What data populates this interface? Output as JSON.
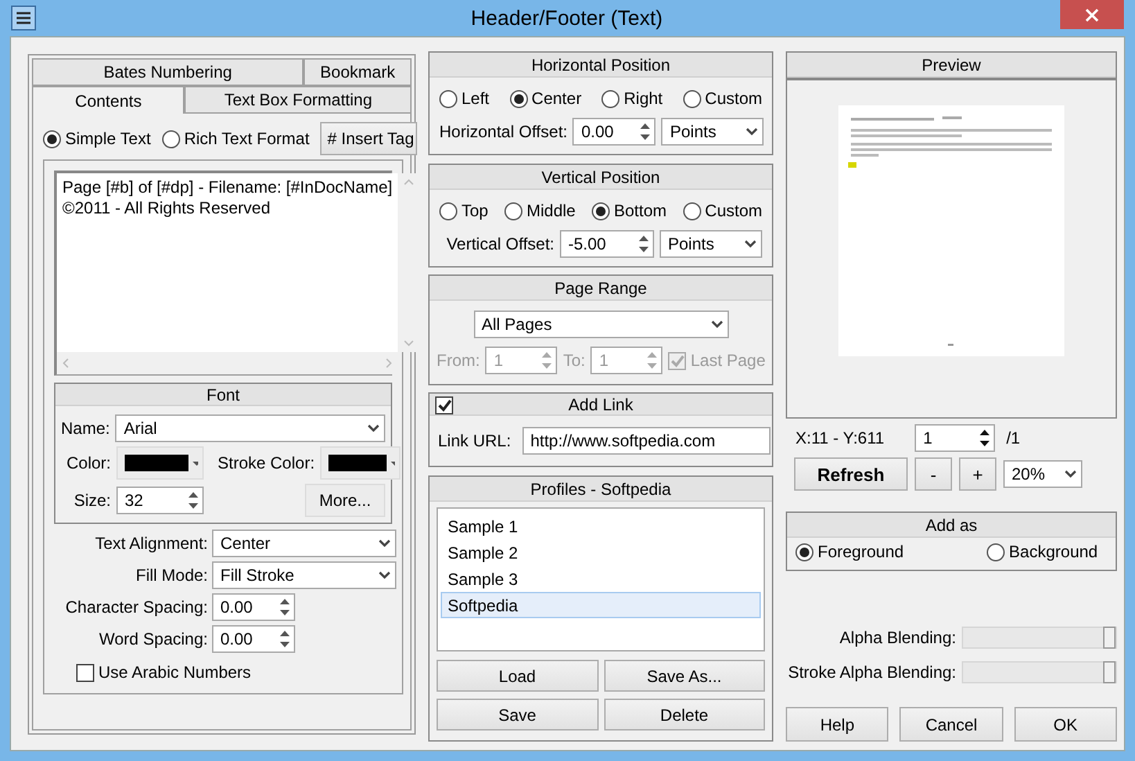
{
  "window": {
    "title": "Header/Footer (Text)"
  },
  "tab_rows": [
    [
      {
        "label": "Bates Numbering",
        "selected": false
      },
      {
        "label": "Bookmark",
        "selected": false
      }
    ],
    [
      {
        "label": "Contents",
        "selected": true
      },
      {
        "label": "Text Box Formatting",
        "selected": false
      }
    ]
  ],
  "content_mode": [
    {
      "label": "Simple Text",
      "selected": true
    },
    {
      "label": "Rich Text Format",
      "selected": false
    }
  ],
  "insert_tag_button": "# Insert Tag",
  "text_lines": [
    "Page [#b] of [#dp] - Filename: [#InDocName]",
    "©2011 - All Rights Reserved"
  ],
  "font": {
    "title": "Font",
    "name_label": "Name:",
    "name_value": "Arial",
    "swatches": [
      {
        "label": "Color:",
        "color": "#000000"
      },
      {
        "label": "Stroke Color:",
        "color": "#000000"
      }
    ],
    "size_label": "Size:",
    "size_value": "32",
    "more_button": "More..."
  },
  "format_fields": [
    {
      "kind": "select",
      "label": "Text Alignment:",
      "value": "Center"
    },
    {
      "kind": "select",
      "label": "Fill Mode:",
      "value": "Fill Stroke"
    },
    {
      "kind": "spin",
      "label": "Character Spacing:",
      "value": "0.00"
    },
    {
      "kind": "spin",
      "label": "Word Spacing:",
      "value": "0.00"
    }
  ],
  "arabic_numbers": {
    "label": "Use Arabic Numbers",
    "checked": false
  },
  "horizontal": {
    "title": "Horizontal Position",
    "options": [
      {
        "label": "Left",
        "selected": false
      },
      {
        "label": "Center",
        "selected": true
      },
      {
        "label": "Right",
        "selected": false
      },
      {
        "label": "Custom",
        "selected": false
      }
    ],
    "offset_label": "Horizontal Offset:",
    "offset_value": "0.00",
    "unit": "Points"
  },
  "vertical": {
    "title": "Vertical Position",
    "options": [
      {
        "label": "Top",
        "selected": false
      },
      {
        "label": "Middle",
        "selected": false
      },
      {
        "label": "Bottom",
        "selected": true
      },
      {
        "label": "Custom",
        "selected": false
      }
    ],
    "offset_label": "Vertical Offset:",
    "offset_value": "-5.00",
    "unit": "Points"
  },
  "page_range": {
    "title": "Page Range",
    "value": "All Pages",
    "disabled": true,
    "from_label": "From:",
    "from_value": "1",
    "to_label": "To:",
    "to_value": "1",
    "last_page_label": "Last Page",
    "last_page_checked": true
  },
  "add_link": {
    "title": "Add Link",
    "checked": true,
    "url_label": "Link URL:",
    "url_value": "http://www.softpedia.com"
  },
  "profiles": {
    "title": "Profiles - Softpedia",
    "items": [
      {
        "label": "Sample 1",
        "selected": false
      },
      {
        "label": "Sample 2",
        "selected": false
      },
      {
        "label": "Sample 3",
        "selected": false
      },
      {
        "label": "Softpedia",
        "selected": true
      }
    ],
    "buttons": [
      "Load",
      "Save As...",
      "Save",
      "Delete"
    ]
  },
  "preview": {
    "title": "Preview",
    "coords": "X:11  - Y:611",
    "page_value": "1",
    "page_total": "/1",
    "refresh_button": "Refresh",
    "minus_button": "-",
    "plus_button": "+",
    "zoom": "20%"
  },
  "add_as": {
    "title": "Add as",
    "options": [
      {
        "label": "Foreground",
        "selected": true
      },
      {
        "label": "Background",
        "selected": false
      }
    ]
  },
  "blending": [
    {
      "label": "Alpha Blending:",
      "level": 1
    },
    {
      "label": "Stroke Alpha Blending:",
      "level": 1
    }
  ],
  "footer_buttons": [
    "Help",
    "Cancel",
    "OK"
  ]
}
